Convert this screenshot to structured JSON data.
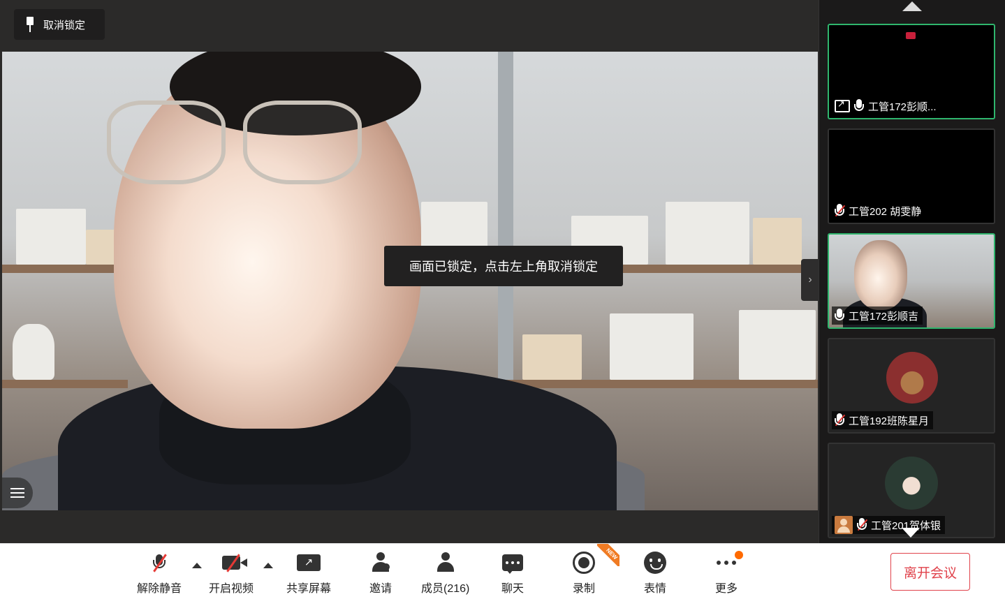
{
  "stage": {
    "unlock_label": "取消锁定",
    "lock_toast": "画面已锁定，点击左上角取消锁定"
  },
  "participants": [
    {
      "name": "工管172彭顺...",
      "status": "sharing",
      "active": true
    },
    {
      "name": "工管202 胡雯静",
      "status": "muted",
      "active": false
    },
    {
      "name": "工管172彭顺吉",
      "status": "speaking",
      "active": true
    },
    {
      "name": "工管192班陈星月",
      "status": "muted",
      "active": false
    },
    {
      "name": "工管201贺体银",
      "status": "muted",
      "active": false
    }
  ],
  "toolbar": {
    "unmute": "解除静音",
    "start_video": "开启视频",
    "share_screen": "共享屏幕",
    "invite": "邀请",
    "members": "成员(216)",
    "chat": "聊天",
    "record": "录制",
    "reactions": "表情",
    "more": "更多",
    "leave": "离开会议",
    "new_badge": "NEW"
  },
  "colors": {
    "active_border": "#2fb56d",
    "leave_red": "#e0424b",
    "mute_red": "#e53935",
    "notify_orange": "#ff6a00"
  }
}
